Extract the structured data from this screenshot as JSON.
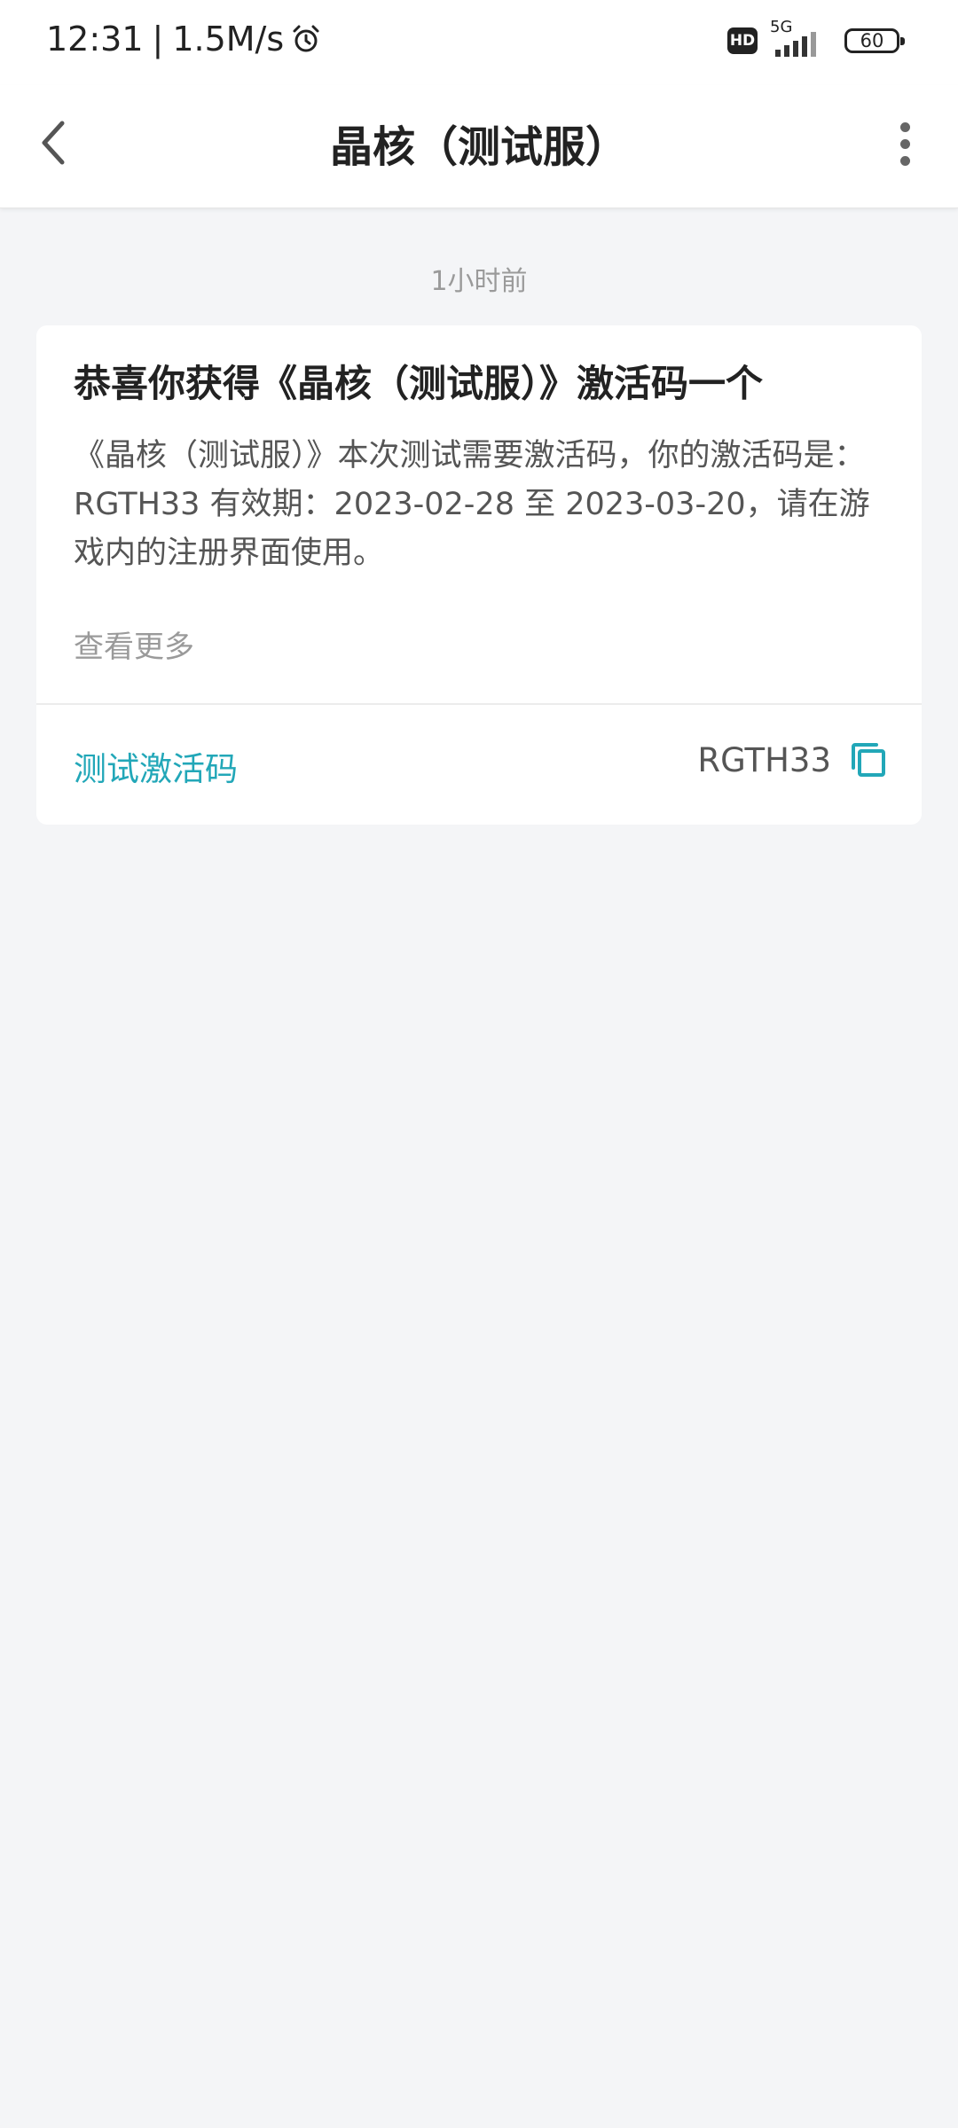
{
  "status_bar": {
    "time": "12:31",
    "separator": "|",
    "speed": "1.5M/s",
    "alarm_icon": "alarm-clock-icon",
    "hd_label": "HD",
    "network_label": "5G",
    "battery_level": "60"
  },
  "nav": {
    "back_icon": "chevron-left-icon",
    "title": "晶核（测试服）",
    "more_icon": "more-vertical-icon"
  },
  "message": {
    "timestamp": "1小时前",
    "title": "恭喜你获得《晶核（测试服）》激活码一个",
    "body": "《晶核（测试服）》本次测试需要激活码，你的激活码是：RGTH33 有效期：2023-02-28 至 2023-03-20，请在游戏内的注册界面使用。",
    "view_more": "查看更多",
    "code_label": "测试激活码",
    "code_value": "RGTH33",
    "copy_icon": "copy-icon"
  },
  "colors": {
    "accent": "#22a7b8",
    "background": "#f4f5f7",
    "card": "#ffffff"
  }
}
